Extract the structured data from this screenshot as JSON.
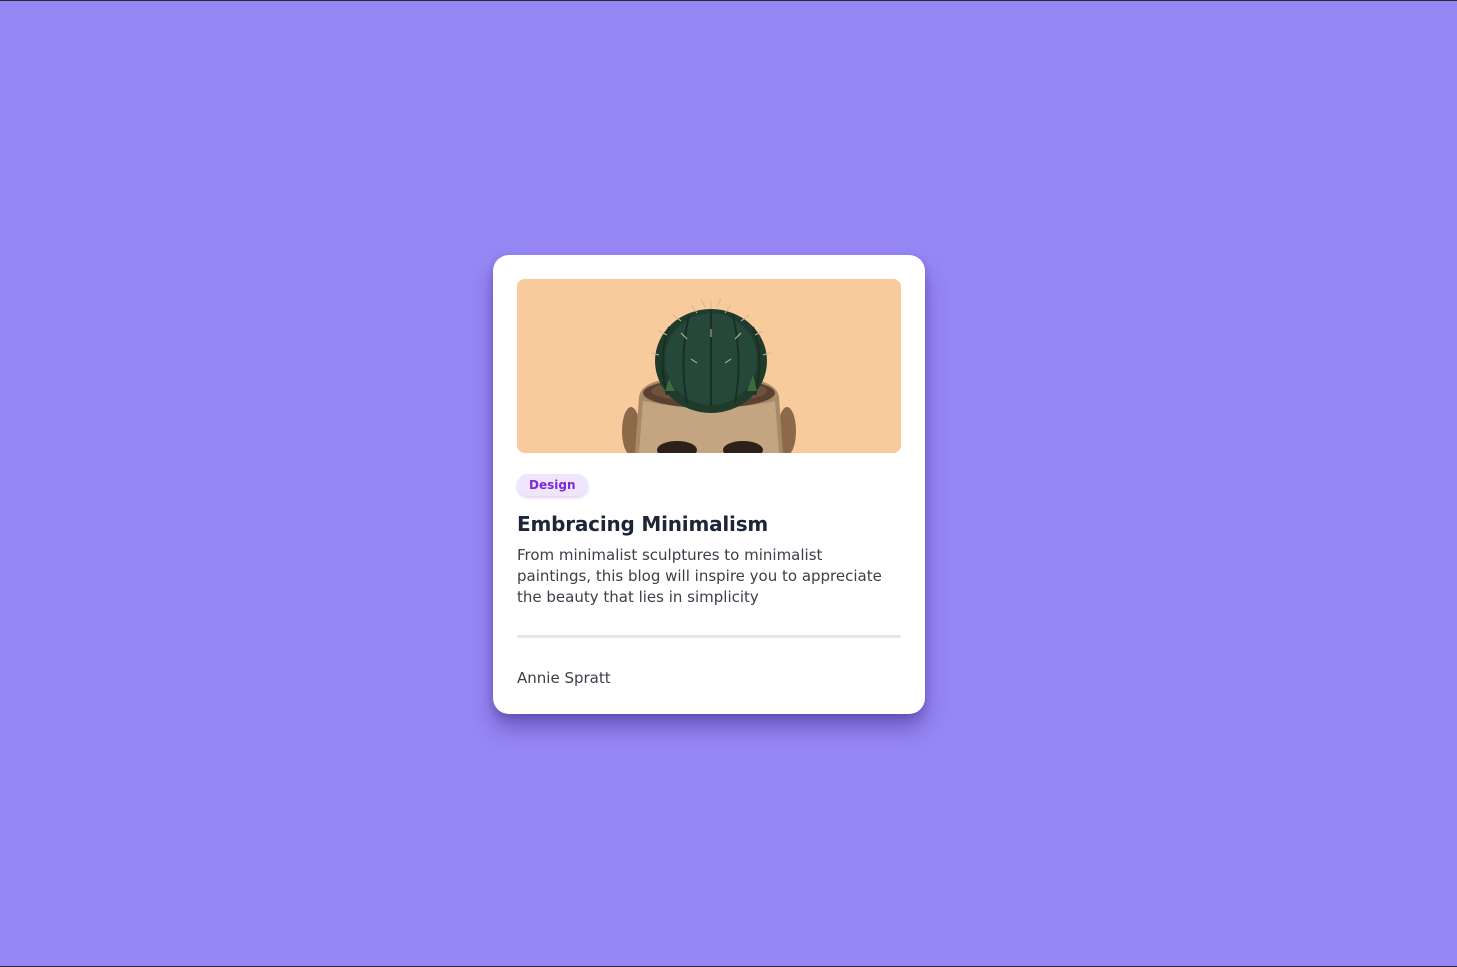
{
  "card": {
    "image": {
      "icon": "cactus-in-skull-pot-photo",
      "background_color": "#f9cb9c"
    },
    "tag": "Design",
    "title": "Embracing Minimalism",
    "description": "From minimalist sculptures to minimalist paintings, this blog will inspire you to appreciate the beauty that lies in simplicity",
    "author": "Annie Spratt"
  },
  "colors": {
    "page_background": "#9787f5",
    "card_background": "#ffffff",
    "tag_background": "#f0e6fb",
    "tag_text": "#7d2ad6",
    "title_text": "#1c2636",
    "body_text": "#3b3f47",
    "divider": "#e1e8ec"
  }
}
